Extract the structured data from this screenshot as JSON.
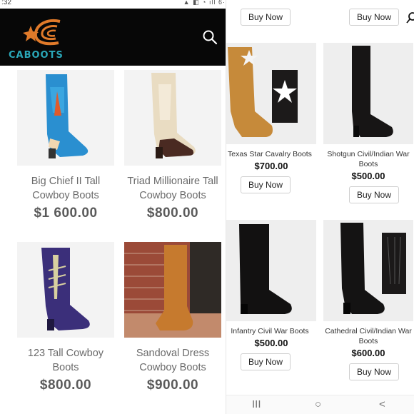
{
  "status": {
    "time": ":32",
    "icons": "▲ ◧ ◔ ıll 6·"
  },
  "header": {
    "brand": "CABOOTS",
    "logo_icon": "caboots-star-logo",
    "search_icon": "search-icon"
  },
  "left_products": [
    {
      "name": "Big Chief II Tall Cowboy Boots",
      "price": "$1 600.00"
    },
    {
      "name": "Triad Millionaire Tall Cowboy Boots",
      "price": "$800.00"
    },
    {
      "name": "123 Tall Cowboy Boots",
      "price": "$800.00"
    },
    {
      "name": "Sandoval Dress Cowboy Boots",
      "price": "$900.00"
    }
  ],
  "right_panel": {
    "buy_label": "Buy Now",
    "products": [
      {
        "name": "Texas Star Cavalry Boots",
        "price": "$700.00"
      },
      {
        "name": "Shotgun Civil/Indian War Boots",
        "price": "$500.00"
      },
      {
        "name": "Infantry Civil War Boots",
        "price": "$500.00"
      },
      {
        "name": "Cathedral Civil/Indian War Boots",
        "price": "$600.00"
      }
    ],
    "search_icon": "search-icon"
  },
  "navbar": {
    "recents": "III",
    "home": "○",
    "back": "<"
  },
  "colors": {
    "header_bg": "#070707",
    "brand_teal": "#2aa7b8",
    "brand_orange": "#e07a2a"
  }
}
